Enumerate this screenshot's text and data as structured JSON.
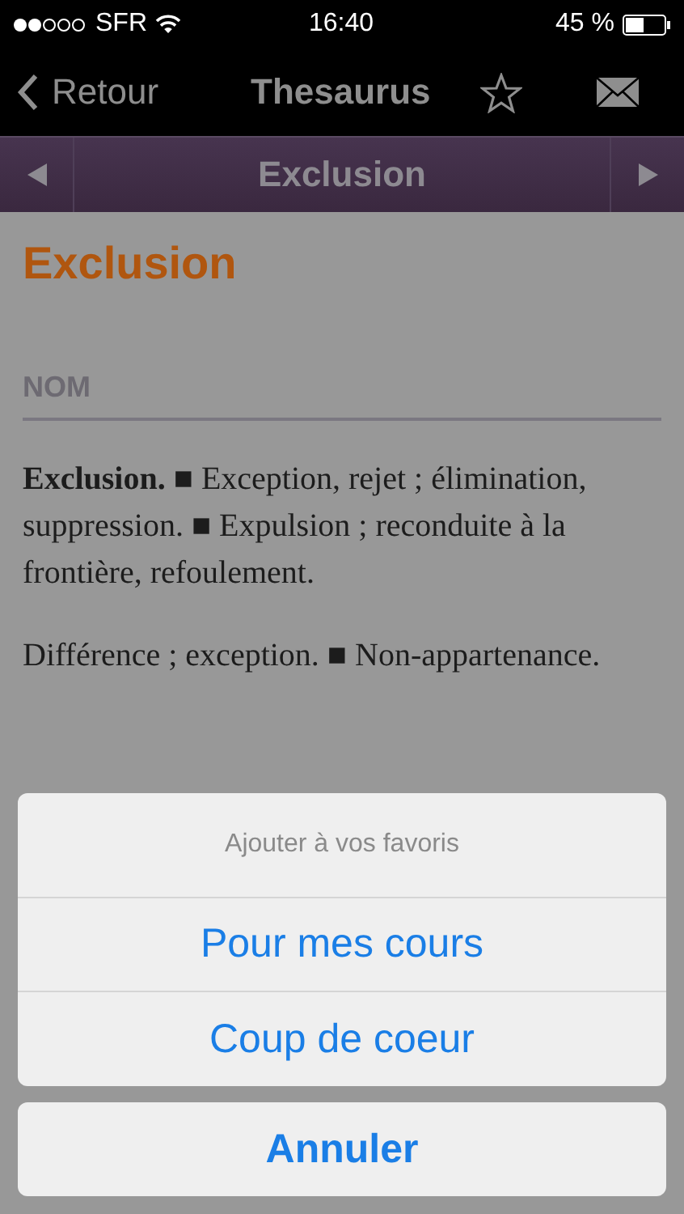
{
  "status_bar": {
    "carrier": "SFR",
    "time": "16:40",
    "battery": "45 %"
  },
  "nav_bar": {
    "back": "Retour",
    "title": "Thesaurus"
  },
  "entry_bar": {
    "title": "Exclusion"
  },
  "entry": {
    "heading": "Exclusion",
    "category": "NOM",
    "paragraphs": [
      "**Exclusion.** ■ Exception, rejet ; élimination, suppression. ■ Expulsion ; reconduite à la frontière, refoulement.",
      "Différence ; exception. ■ Non-appartenance."
    ]
  },
  "action_sheet": {
    "title": "Ajouter à vos favoris",
    "options": [
      "Pour mes cours",
      "Coup de coeur"
    ],
    "cancel": "Annuler"
  }
}
